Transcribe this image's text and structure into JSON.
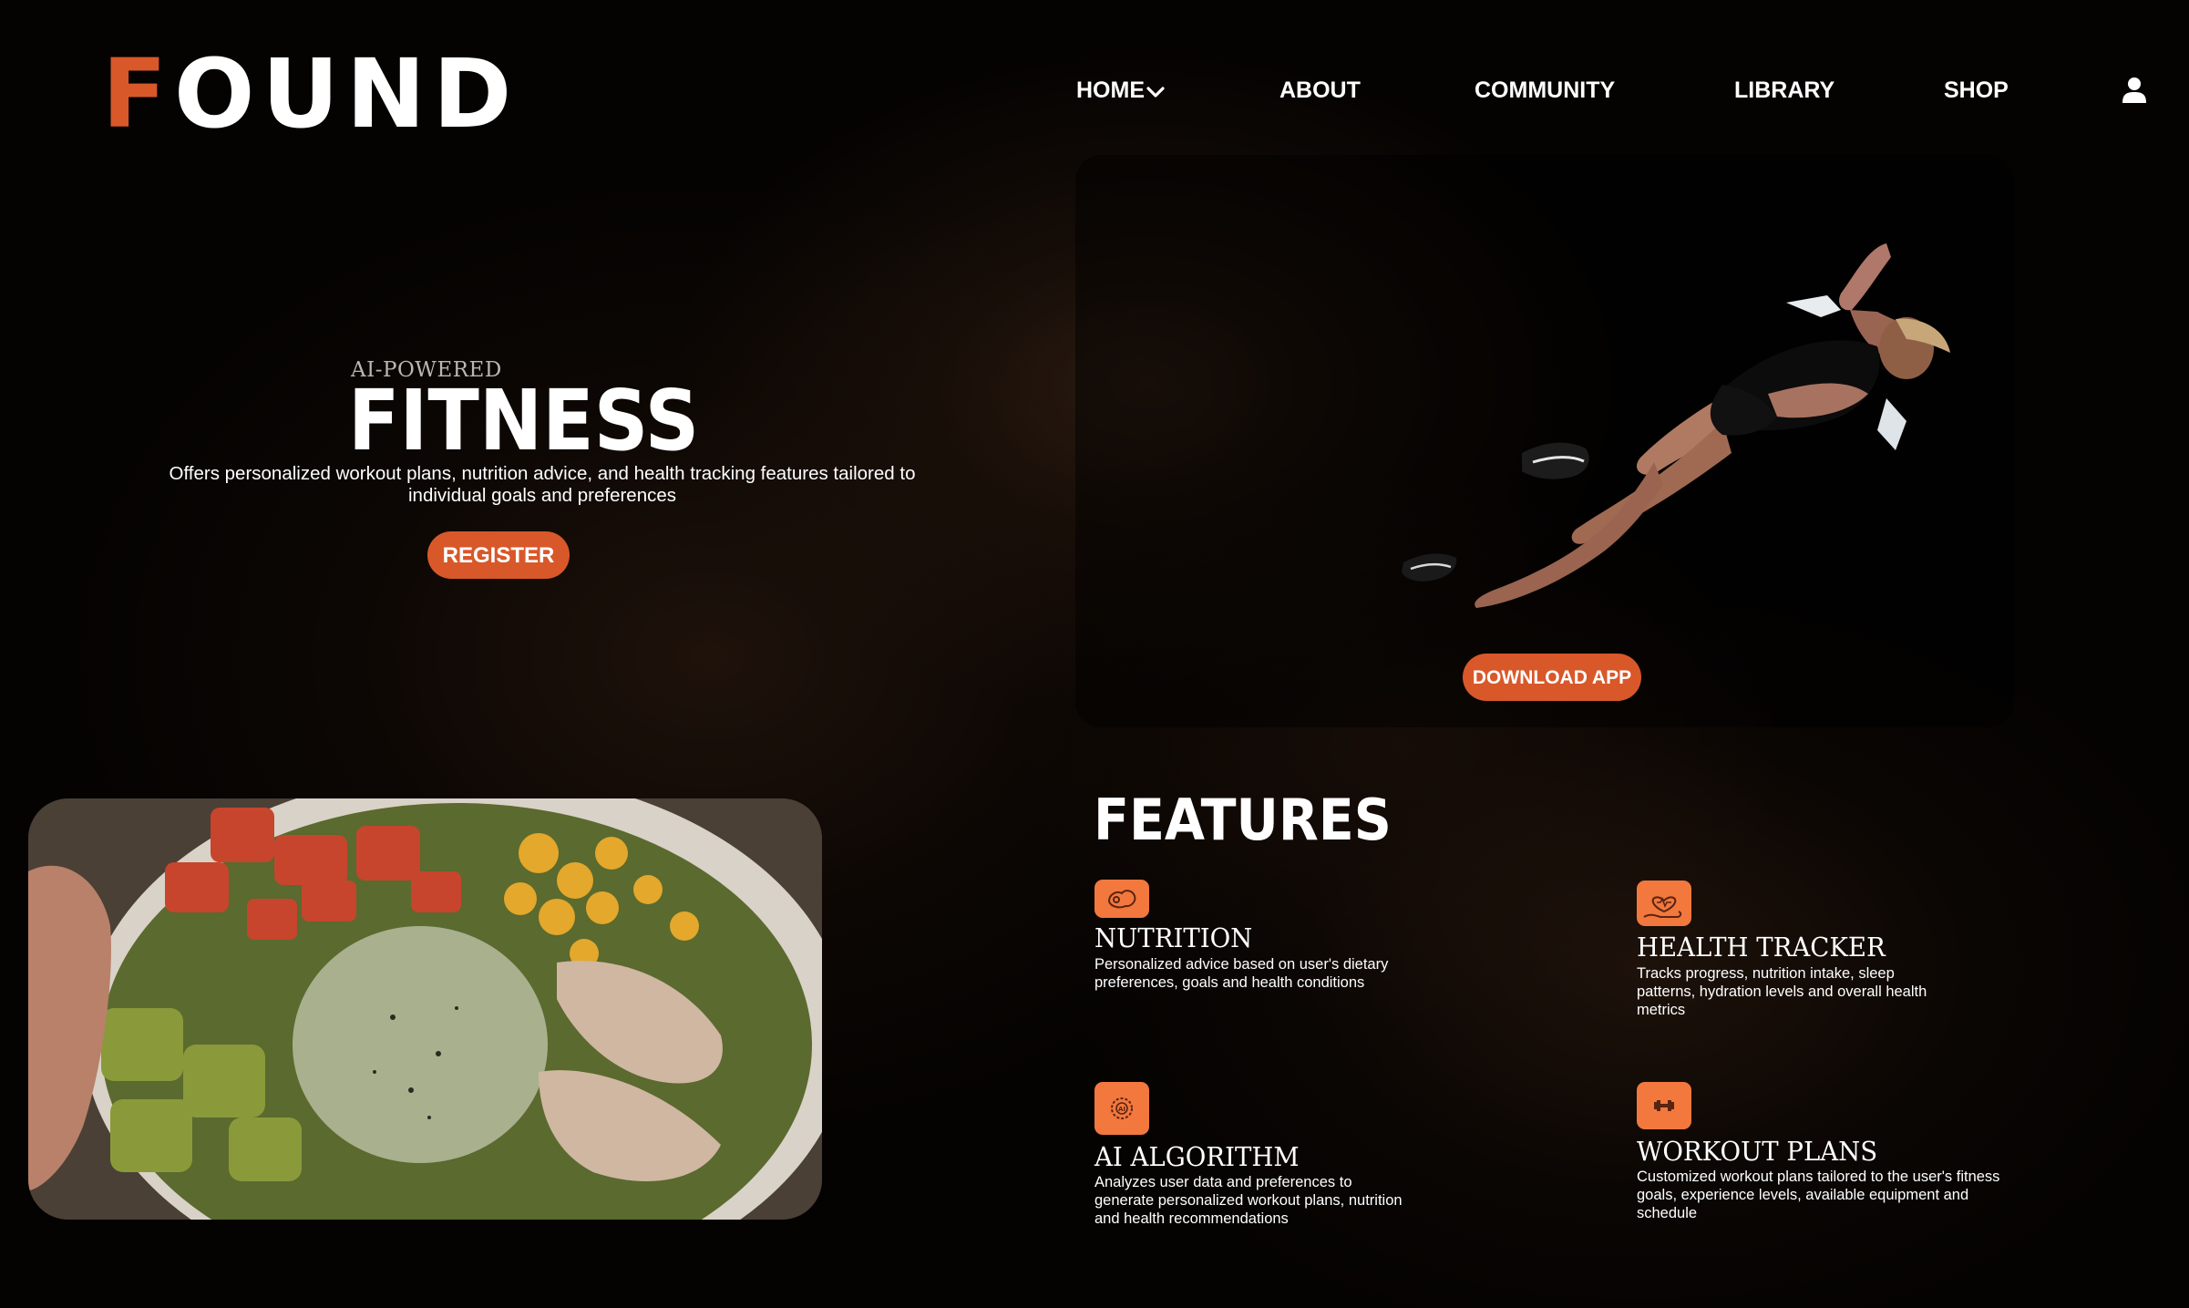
{
  "header": {
    "logo_first": "F",
    "logo_rest": "OUND",
    "nav": [
      {
        "label": "HOME",
        "icon": "chevron-down-icon"
      },
      {
        "label": "ABOUT"
      },
      {
        "label": "COMMUNITY"
      },
      {
        "label": "LIBRARY"
      },
      {
        "label": "SHOP"
      }
    ],
    "user_icon": "user-icon"
  },
  "hero": {
    "eyebrow": "AI-POWERED",
    "title": "FITNESS",
    "description": "Offers personalized workout plans, nutrition advice, and health tracking features tailored to individual goals and preferences",
    "register_label": "REGISTER"
  },
  "app_card": {
    "download_label": "DOWNLOAD APP"
  },
  "features": {
    "title": "FEATURES",
    "items": [
      {
        "icon": "bicep-icon",
        "title": "NUTRITION",
        "description": "Personalized advice based on user's dietary preferences, goals and health conditions"
      },
      {
        "icon": "heart-hand-icon",
        "title": "HEALTH TRACKER",
        "description": "Tracks progress, nutrition intake, sleep patterns, hydration levels and overall health metrics"
      },
      {
        "icon": "ai-chip-icon",
        "title": "AI ALGORITHM",
        "description": "Analyzes user data and preferences to generate personalized workout plans, nutrition and health recommendations"
      },
      {
        "icon": "dumbbell-icon",
        "title": "WORKOUT PLANS",
        "description": "Customized workout plans tailored to the user's fitness goals, experience levels, available equipment and schedule"
      }
    ]
  },
  "colors": {
    "accent": "#d8582a",
    "icon_tile": "#f2783e",
    "background": "#050302"
  }
}
